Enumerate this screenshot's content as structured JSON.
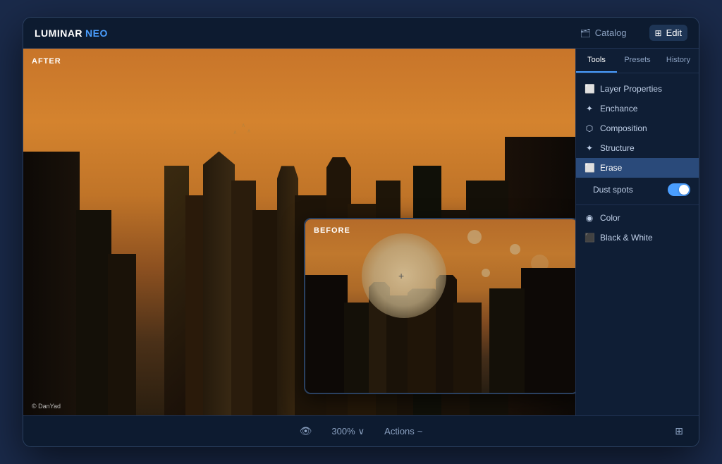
{
  "app": {
    "name_luminar": "LUMINAR",
    "name_neo": "NEO"
  },
  "header": {
    "catalog_label": "Catalog",
    "edit_label": "Edit",
    "catalog_icon": "📁",
    "edit_icon": "⊞"
  },
  "canvas": {
    "after_label": "AFTER",
    "before_label": "BEFORE",
    "copyright": "© DanYad"
  },
  "right_panel": {
    "tabs": [
      {
        "id": "tools",
        "label": "Tools",
        "active": true
      },
      {
        "id": "presets",
        "label": "Presets",
        "active": false
      },
      {
        "id": "history",
        "label": "History",
        "active": false
      }
    ],
    "items": [
      {
        "id": "layer-properties",
        "label": "Layer Properties",
        "icon": "⬜",
        "active": false
      },
      {
        "id": "enhance",
        "label": "Enchance",
        "icon": "✦",
        "active": false
      },
      {
        "id": "composition",
        "label": "Composition",
        "icon": "⬛",
        "active": false
      },
      {
        "id": "structure",
        "label": "Structure",
        "icon": "✦",
        "active": false
      },
      {
        "id": "erase",
        "label": "Erase",
        "icon": "⬜",
        "active": true
      },
      {
        "id": "color",
        "label": "Color",
        "icon": "◉",
        "active": false
      },
      {
        "id": "black-white",
        "label": "Black & White",
        "icon": "⬛",
        "active": false
      }
    ],
    "dust_spots_label": "Dust spots"
  },
  "toolbar": {
    "view_icon": "👁",
    "zoom_label": "300%",
    "zoom_chevron": "∨",
    "actions_label": "Actions",
    "actions_chevron": "~",
    "apple_icon": "",
    "windows_icon": "⊞"
  }
}
